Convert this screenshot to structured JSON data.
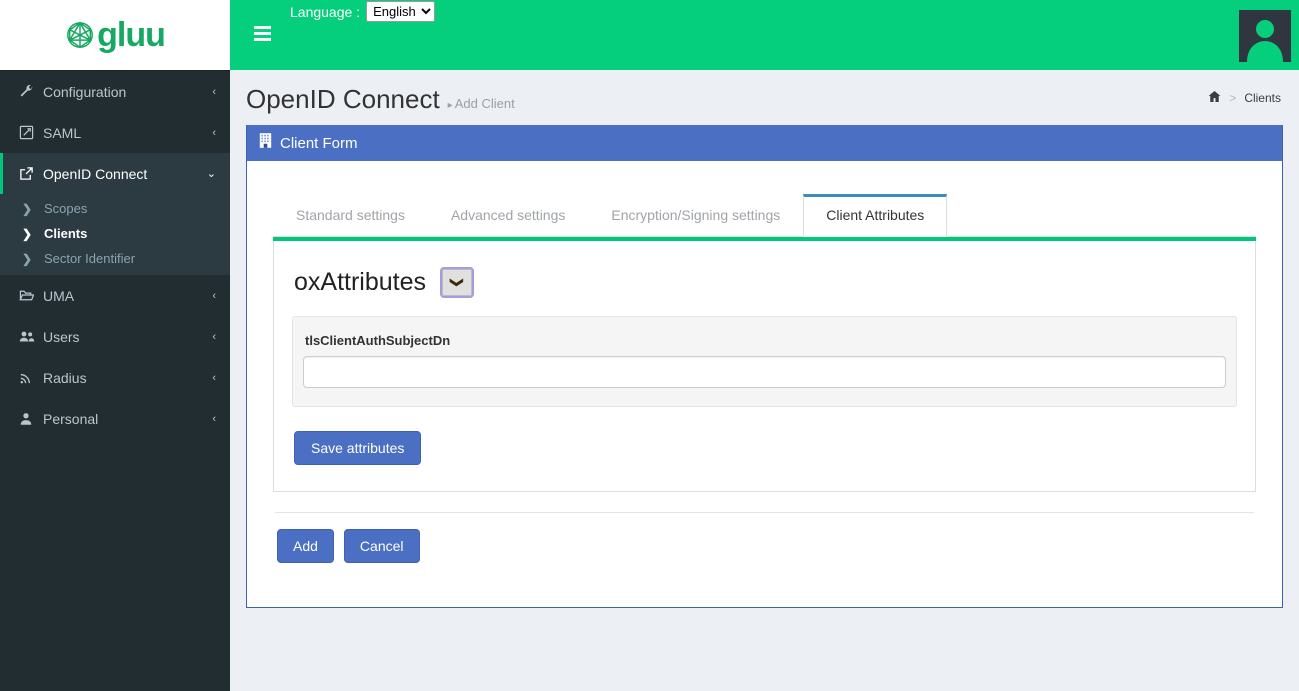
{
  "topbar": {
    "logo_text": "gluu",
    "logo_icon": "gluu-polyhedron-logo",
    "language_label": "Language :",
    "language_value": "English",
    "language_options": [
      "English"
    ],
    "menu_icon": "hamburger-menu-icon",
    "avatar_icon": "user-avatar-icon"
  },
  "sidebar": {
    "items": [
      {
        "label": "Configuration",
        "icon": "wrench-icon",
        "chevron": "‹",
        "active": false
      },
      {
        "label": "SAML",
        "icon": "edit-square-icon",
        "chevron": "‹",
        "active": false
      },
      {
        "label": "OpenID Connect",
        "icon": "external-link-icon",
        "chevron": "⌄",
        "active": true
      },
      {
        "label": "UMA",
        "icon": "folder-open-icon",
        "chevron": "‹",
        "active": false
      },
      {
        "label": "Users",
        "icon": "users-group-icon",
        "chevron": "‹",
        "active": false
      },
      {
        "label": "Radius",
        "icon": "signal-waves-icon",
        "chevron": "‹",
        "active": false
      },
      {
        "label": "Personal",
        "icon": "person-icon",
        "chevron": "‹",
        "active": false
      }
    ],
    "submenu": [
      {
        "label": "Scopes",
        "icon": "chevron-right-icon",
        "selected": false
      },
      {
        "label": "Clients",
        "icon": "chevron-right-icon",
        "selected": true
      },
      {
        "label": "Sector Identifier",
        "icon": "chevron-right-icon",
        "selected": false
      }
    ]
  },
  "page": {
    "title": "OpenID Connect",
    "subtitle": "Add Client",
    "subtitle_caret": "▸",
    "breadcrumb": {
      "home_icon": "home-icon",
      "separator": ">",
      "current": "Clients"
    }
  },
  "box": {
    "icon": "building-icon",
    "title": "Client Form"
  },
  "tabs": [
    {
      "label": "Standard settings",
      "active": false
    },
    {
      "label": "Advanced settings",
      "active": false
    },
    {
      "label": "Encryption/Signing settings",
      "active": false
    },
    {
      "label": "Client Attributes",
      "active": true
    }
  ],
  "client_attributes": {
    "section_title": "oxAttributes",
    "toggle_icon": "chevron-down-icon",
    "fields": [
      {
        "label": "tlsClientAuthSubjectDn",
        "value": "",
        "placeholder": ""
      }
    ],
    "save_label": "Save attributes"
  },
  "form_actions": {
    "add_label": "Add",
    "cancel_label": "Cancel"
  },
  "colors": {
    "brand_green": "#05ce7c",
    "sidebar_dark": "#222d32",
    "panel_blue": "#4a6fc3",
    "tab_accent_blue": "#3c8dbc",
    "accent_green": "#00c87b",
    "page_bg": "#ecf0f5",
    "focus_purple": "#a89ae0"
  }
}
